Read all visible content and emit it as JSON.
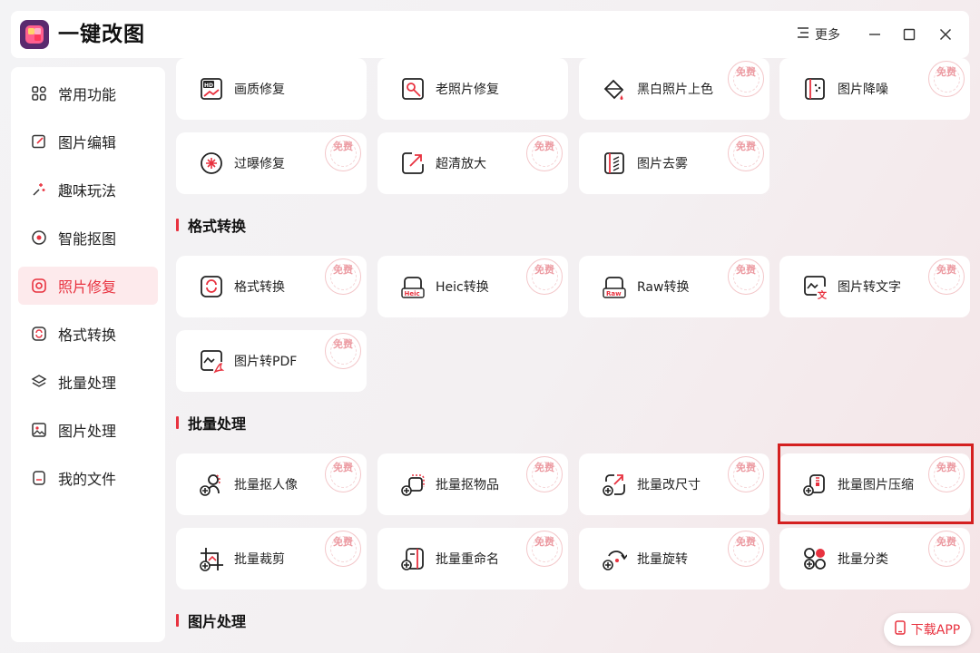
{
  "header": {
    "title": "一键改图",
    "more_label": "更多"
  },
  "sidebar": {
    "items": [
      {
        "label": "常用功能",
        "icon": "grid-icon"
      },
      {
        "label": "图片编辑",
        "icon": "edit-icon"
      },
      {
        "label": "趣味玩法",
        "icon": "sparkle-icon"
      },
      {
        "label": "智能抠图",
        "icon": "target-icon"
      },
      {
        "label": "照片修复",
        "icon": "repair-icon",
        "active": true
      },
      {
        "label": "格式转换",
        "icon": "convert-icon"
      },
      {
        "label": "批量处理",
        "icon": "layers-icon"
      },
      {
        "label": "图片处理",
        "icon": "image-icon"
      },
      {
        "label": "我的文件",
        "icon": "file-icon"
      }
    ]
  },
  "repair": {
    "cards": [
      {
        "label": "画质修复",
        "free": false
      },
      {
        "label": "老照片修复",
        "free": false
      },
      {
        "label": "黑白照片上色",
        "free": true
      },
      {
        "label": "图片降噪",
        "free": true
      },
      {
        "label": "过曝修复",
        "free": true
      },
      {
        "label": "超清放大",
        "free": true
      },
      {
        "label": "图片去雾",
        "free": true
      }
    ]
  },
  "sections": {
    "format": {
      "title": "格式转换",
      "cards": [
        {
          "label": "格式转换",
          "free": true
        },
        {
          "label": "Heic转换",
          "free": true
        },
        {
          "label": "Raw转换",
          "free": true
        },
        {
          "label": "图片转文字",
          "free": true
        },
        {
          "label": "图片转PDF",
          "free": true
        }
      ]
    },
    "batch": {
      "title": "批量处理",
      "cards": [
        {
          "label": "批量抠人像",
          "free": true
        },
        {
          "label": "批量抠物品",
          "free": true
        },
        {
          "label": "批量改尺寸",
          "free": true
        },
        {
          "label": "批量图片压缩",
          "free": true
        },
        {
          "label": "批量裁剪",
          "free": true
        },
        {
          "label": "批量重命名",
          "free": true
        },
        {
          "label": "批量旋转",
          "free": true
        },
        {
          "label": "批量分类",
          "free": true
        }
      ]
    },
    "image": {
      "title": "图片处理"
    }
  },
  "free_badge": "免费",
  "download": {
    "label": "下载APP"
  },
  "colors": {
    "accent": "#e8323f",
    "highlight": "#d42020"
  }
}
